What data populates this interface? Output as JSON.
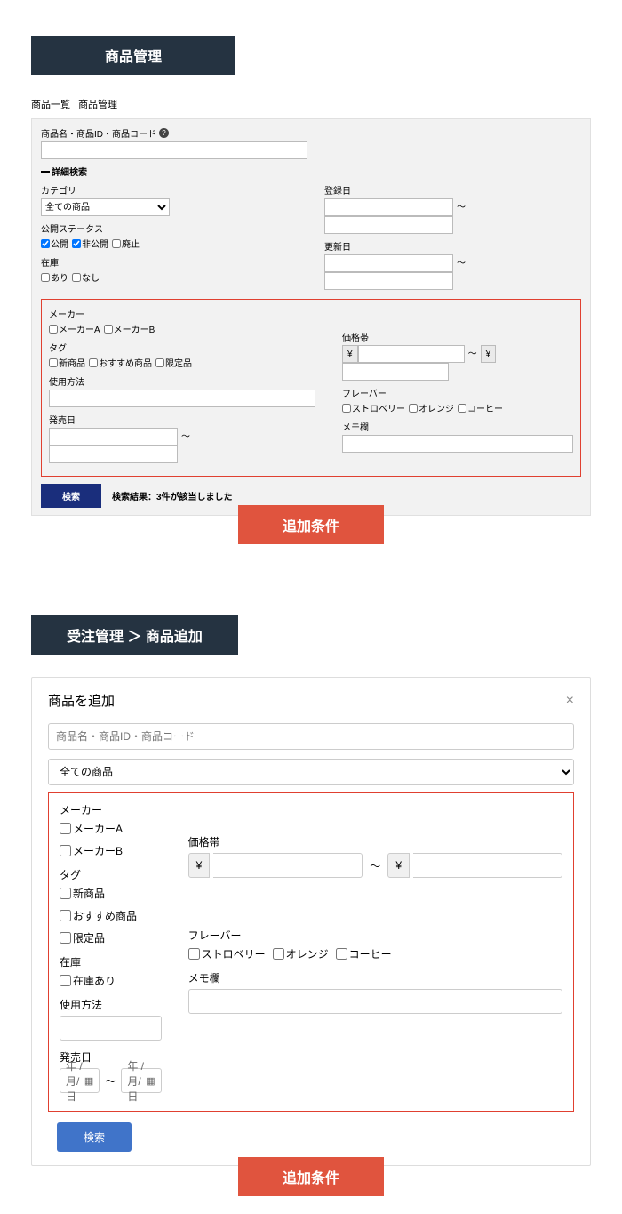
{
  "section1": {
    "title": "商品管理",
    "breadcrumb": {
      "a": "商品一覧",
      "b": "商品管理"
    },
    "search_label": "商品名・商品ID・商品コード",
    "detail_toggle": "詳細検索",
    "category": {
      "label": "カテゴリ",
      "selected": "全ての商品"
    },
    "status": {
      "label": "公開ステータス",
      "opts": [
        "公開",
        "非公開",
        "廃止"
      ],
      "checked": [
        true,
        true,
        false
      ]
    },
    "stock": {
      "label": "在庫",
      "opts": [
        "あり",
        "なし"
      ]
    },
    "reg_date": {
      "label": "登録日"
    },
    "upd_date": {
      "label": "更新日"
    },
    "maker": {
      "label": "メーカー",
      "opts": [
        "メーカーA",
        "メーカーB"
      ]
    },
    "tag": {
      "label": "タグ",
      "opts": [
        "新商品",
        "おすすめ商品",
        "限定品"
      ]
    },
    "usage": {
      "label": "使用方法"
    },
    "release": {
      "label": "発売日"
    },
    "price": {
      "label": "価格帯",
      "yen": "¥"
    },
    "flavor": {
      "label": "フレーバー",
      "opts": [
        "ストロベリー",
        "オレンジ",
        "コーヒー"
      ]
    },
    "memo": {
      "label": "メモ欄"
    },
    "search_btn": "検索",
    "result": "検索結果：3件が該当しました",
    "badge": "追加条件",
    "sep": "～"
  },
  "section2": {
    "title": "受注管理 ＞ 商品追加",
    "modal_title": "商品を追加",
    "close": "×",
    "placeholder": "商品名・商品ID・商品コード",
    "cat_selected": "全ての商品",
    "maker": {
      "label": "メーカー",
      "opts": [
        "メーカーA",
        "メーカーB"
      ]
    },
    "tag": {
      "label": "タグ",
      "opts": [
        "新商品",
        "おすすめ商品",
        "限定品"
      ]
    },
    "stock": {
      "label": "在庫",
      "opt": "在庫あり"
    },
    "usage": {
      "label": "使用方法"
    },
    "release": {
      "label": "発売日",
      "date_ph": "年 /月/日"
    },
    "price": {
      "label": "価格帯",
      "yen": "¥"
    },
    "flavor": {
      "label": "フレーバー",
      "opts": [
        "ストロベリー",
        "オレンジ",
        "コーヒー"
      ]
    },
    "memo": {
      "label": "メモ欄"
    },
    "search_btn": "検索",
    "badge": "追加条件",
    "sep": "～"
  }
}
